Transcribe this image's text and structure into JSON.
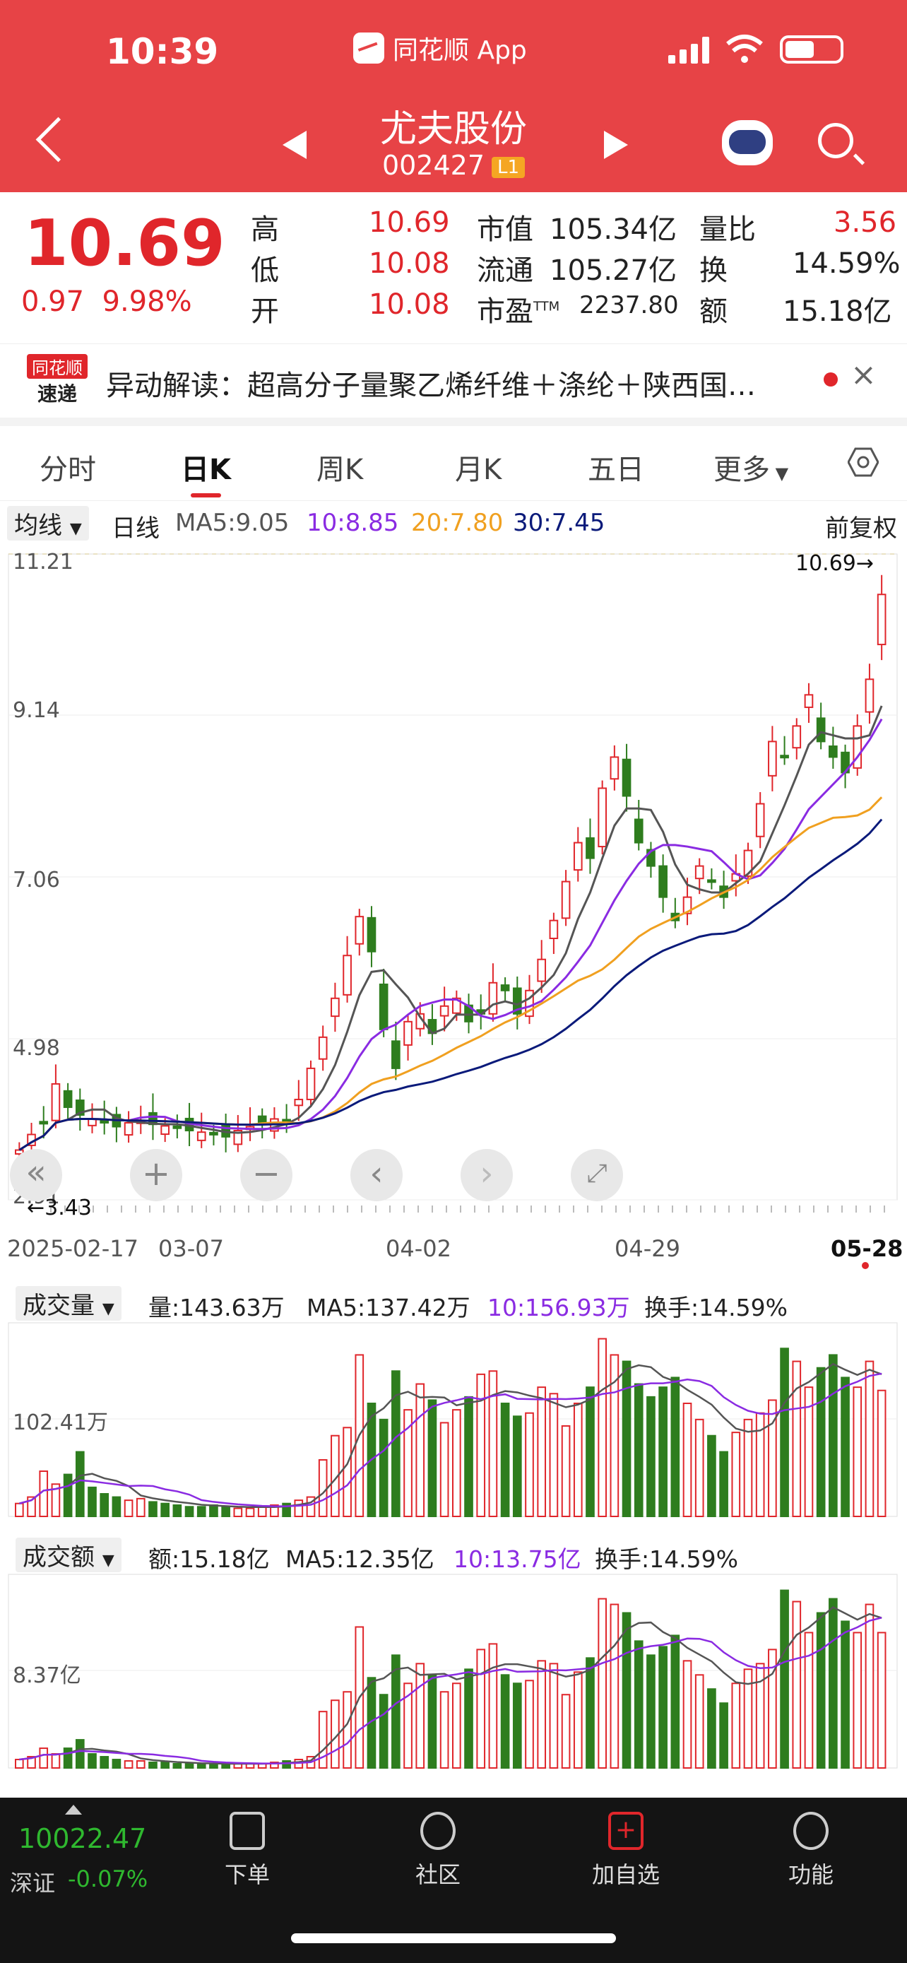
{
  "status": {
    "time": "10:39",
    "app": "同花顺 App"
  },
  "stock": {
    "name": "尤夫股份",
    "code": "002427",
    "level": "L1"
  },
  "quote": {
    "price": "10.69",
    "change": "0.97",
    "change_pct": "9.98%",
    "high_label": "高",
    "high": "10.69",
    "low_label": "低",
    "low": "10.08",
    "open_label": "开",
    "open": "10.08",
    "mktcap_label": "市值",
    "mktcap": "105.34亿",
    "float_label": "流通",
    "float": "105.27亿",
    "pe_label": "市盈",
    "pe_sup": "TTM",
    "pe": "2237.80",
    "vr_label": "量比",
    "vr": "3.56",
    "turn_label": "换",
    "turn": "14.59%",
    "amt_label": "额",
    "amt": "15.18亿"
  },
  "notice": {
    "logo_top": "同花顺",
    "logo_bottom": "速递",
    "text": "异动解读：超高分子量聚乙烯纤维＋涤纶＋陕西国…"
  },
  "tabs": [
    "分时",
    "日K",
    "周K",
    "月K",
    "五日",
    "更多"
  ],
  "active_tab": 1,
  "ma": {
    "selector": "均线",
    "period": "日线",
    "ma5": "MA5:9.05",
    "ma10": "10:8.85",
    "ma20": "20:7.80",
    "ma30": "30:7.45",
    "adjust": "前复权"
  },
  "colors": {
    "up": "#e0262b",
    "down": "#2e7d1e",
    "ma5": "#555555",
    "ma10": "#8a2be2",
    "ma20": "#f0a020",
    "ma30": "#0a1a7a"
  },
  "price_axis": {
    "top": "11.21",
    "t2": "9.14",
    "t3": "7.06",
    "t4": "4.98",
    "bottom": "2.91",
    "max_marker": "10.69→",
    "min_marker": "←3.43"
  },
  "chart_data": [
    {
      "type": "candlestick",
      "title": "日K",
      "x": [
        "2025-02-17",
        "03-07",
        "04-02",
        "04-29",
        "05-28"
      ],
      "ylim": [
        2.91,
        11.21
      ],
      "y_ticks": [
        11.21,
        9.14,
        7.06,
        4.98,
        2.91
      ],
      "close": [
        3.55,
        3.75,
        3.9,
        4.4,
        4.1,
        4.0,
        3.95,
        3.9,
        3.85,
        3.9,
        3.92,
        3.88,
        3.86,
        3.85,
        3.8,
        3.78,
        3.76,
        3.72,
        3.8,
        3.85,
        3.9,
        3.95,
        3.92,
        4.2,
        4.6,
        5.0,
        5.5,
        6.05,
        6.55,
        6.1,
        5.1,
        4.6,
        5.2,
        5.3,
        5.05,
        5.4,
        5.5,
        5.2,
        5.3,
        5.7,
        5.6,
        5.3,
        5.6,
        6.0,
        6.5,
        7.0,
        7.5,
        7.3,
        8.2,
        8.6,
        8.1,
        7.5,
        7.2,
        6.8,
        6.5,
        6.8,
        7.2,
        7.0,
        6.8,
        7.1,
        7.4,
        8.0,
        8.8,
        8.6,
        9.0,
        9.4,
        8.8,
        8.6,
        8.4,
        9.0,
        9.6,
        10.69
      ],
      "ma5_last": 9.05,
      "ma10_last": 8.85,
      "ma20_last": 7.8,
      "ma30_last": 7.45,
      "max": 10.69,
      "min": 3.43
    },
    {
      "type": "bar",
      "title": "成交量",
      "stats": {
        "vol": "量:143.63万",
        "ma5": "MA5:137.42万",
        "ma10": "10:156.93万",
        "turn": "换手:14.59%"
      },
      "y_tick": "102.41万",
      "values": [
        8,
        12,
        28,
        20,
        26,
        40,
        18,
        14,
        12,
        10,
        11,
        9,
        8,
        7,
        6,
        6,
        7,
        6,
        5,
        5,
        6,
        7,
        8,
        10,
        12,
        35,
        50,
        55,
        100,
        70,
        60,
        90,
        66,
        82,
        72,
        58,
        66,
        74,
        88,
        90,
        70,
        62,
        64,
        80,
        76,
        56,
        70,
        80,
        110,
        100,
        96,
        82,
        74,
        80,
        86,
        70,
        60,
        50,
        40,
        52,
        60,
        64,
        72,
        104,
        96,
        80,
        92,
        100,
        86,
        80,
        96,
        78
      ]
    },
    {
      "type": "bar",
      "title": "成交额",
      "stats": {
        "amt": "额:15.18亿",
        "ma5": "MA5:12.35亿",
        "ma10": "10:13.75亿",
        "turn": "换手:14.59%"
      },
      "y_tick": "8.37亿",
      "values": [
        6,
        8,
        14,
        10,
        14,
        20,
        10,
        8,
        6,
        5,
        5,
        4,
        4,
        3,
        3,
        3,
        3,
        3,
        3,
        3,
        3,
        4,
        5,
        6,
        8,
        40,
        48,
        54,
        100,
        64,
        52,
        80,
        60,
        74,
        66,
        54,
        60,
        70,
        84,
        88,
        66,
        60,
        62,
        76,
        74,
        52,
        68,
        78,
        120,
        116,
        110,
        90,
        80,
        86,
        94,
        76,
        66,
        56,
        46,
        60,
        70,
        74,
        84,
        126,
        118,
        96,
        110,
        120,
        104,
        96,
        116,
        96
      ]
    }
  ],
  "x_labels": [
    "2025-02-17",
    "03-07",
    "04-02",
    "04-29",
    "05-28"
  ],
  "volume_panel": {
    "selector": "成交量",
    "vol": "量:143.63万",
    "ma5": "MA5:137.42万",
    "ma10": "10:156.93万",
    "turn": "换手:14.59%",
    "tick": "102.41万"
  },
  "amount_panel": {
    "selector": "成交额",
    "amt": "额:15.18亿",
    "ma5": "MA5:12.35亿",
    "ma10": "10:13.75亿",
    "turn": "换手:14.59%",
    "tick": "8.37亿"
  },
  "index": {
    "value": "10022.47",
    "name": "深证",
    "change": "-0.07%"
  },
  "nav": [
    "下单",
    "社区",
    "加自选",
    "功能"
  ]
}
